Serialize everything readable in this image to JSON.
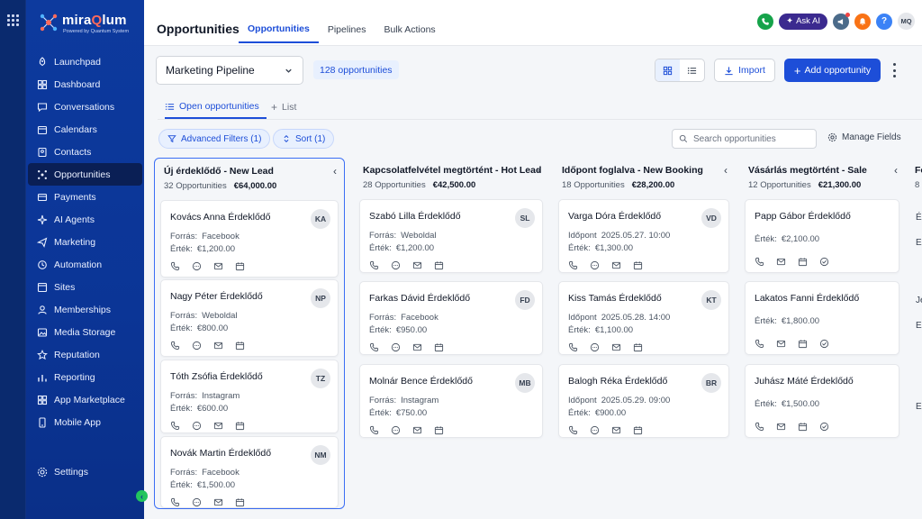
{
  "brand": {
    "name_pre": "mira",
    "name_accent": "Q",
    "name_post": "lum",
    "tagline": "Powered by Quantum System"
  },
  "sidebar": {
    "items": [
      {
        "label": "Launchpad",
        "icon": "rocket-icon"
      },
      {
        "label": "Dashboard",
        "icon": "dashboard-icon"
      },
      {
        "label": "Conversations",
        "icon": "chat-icon"
      },
      {
        "label": "Calendars",
        "icon": "calendar-icon"
      },
      {
        "label": "Contacts",
        "icon": "contacts-icon"
      },
      {
        "label": "Opportunities",
        "icon": "opportunities-icon",
        "active": true
      },
      {
        "label": "Payments",
        "icon": "payments-icon"
      },
      {
        "label": "AI Agents",
        "icon": "ai-agents-icon"
      },
      {
        "label": "Marketing",
        "icon": "marketing-icon"
      },
      {
        "label": "Automation",
        "icon": "automation-icon"
      },
      {
        "label": "Sites",
        "icon": "sites-icon"
      },
      {
        "label": "Memberships",
        "icon": "memberships-icon"
      },
      {
        "label": "Media Storage",
        "icon": "media-icon"
      },
      {
        "label": "Reputation",
        "icon": "star-icon"
      },
      {
        "label": "Reporting",
        "icon": "reporting-icon"
      },
      {
        "label": "App Marketplace",
        "icon": "marketplace-icon"
      },
      {
        "label": "Mobile App",
        "icon": "mobile-icon"
      }
    ],
    "settings_label": "Settings"
  },
  "header": {
    "title": "Opportunities",
    "tabs": [
      {
        "label": "Opportunities",
        "active": true
      },
      {
        "label": "Pipelines"
      },
      {
        "label": "Bulk Actions"
      }
    ],
    "ask_ai": "Ask AI",
    "help": "?",
    "avatar": "MQ",
    "colors": {
      "phone": "#16a34a",
      "askai": "#3b2a8f",
      "megaphone": "#4b6b8a",
      "bell": "#f97316",
      "help": "#3b82f6"
    }
  },
  "toolbar": {
    "pipeline": "Marketing Pipeline",
    "count": "128 opportunities",
    "import": "Import",
    "add": "Add opportunity"
  },
  "subtabs": {
    "open": "Open opportunities",
    "list": "List"
  },
  "filters": {
    "advanced": "Advanced Filters (1)",
    "sort": "Sort (1)",
    "search_placeholder": "Search opportunities",
    "manage": "Manage Fields"
  },
  "labels": {
    "source": "Forrás:",
    "value": "Érték:",
    "appointment": "Időpont"
  },
  "columns": [
    {
      "title": "Új érdeklődő - New Lead",
      "count": "32 Opportunities",
      "total": "€64,000.00",
      "cards": [
        {
          "name": "Kovács Anna Érdeklődő",
          "initials": "KA",
          "source": "Facebook",
          "value": "€1,200.00"
        },
        {
          "name": "Nagy Péter Érdeklődő",
          "initials": "NP",
          "source": "Weboldal",
          "value": "€800.00"
        },
        {
          "name": "Tóth Zsófia Érdeklődő",
          "initials": "TZ",
          "source": "Instagram",
          "value": "€600.00"
        },
        {
          "name": "Novák Martin Érdeklődő",
          "initials": "NM",
          "source": "Facebook",
          "value": "€1,500.00"
        }
      ]
    },
    {
      "title": "Kapcsolatfelvétel megtörtént - Hot Lead",
      "count": "28 Opportunities",
      "total": "€42,500.00",
      "cards": [
        {
          "name": "Szabó Lilla Érdeklődő",
          "initials": "SL",
          "source": "Weboldal",
          "value": "€1,200.00"
        },
        {
          "name": "Farkas Dávid Érdeklődő",
          "initials": "FD",
          "source": "Facebook",
          "value": "€950.00"
        },
        {
          "name": "Molnár Bence Érdeklődő",
          "initials": "MB",
          "source": "Instagram",
          "value": "€750.00"
        }
      ]
    },
    {
      "title": "Időpont foglalva - New Booking",
      "count": "18 Opportunities",
      "total": "€28,200.00",
      "cards": [
        {
          "name": "Varga Dóra Érdeklődő",
          "initials": "VD",
          "date": "2025.05.27. 10:00",
          "value": "€1,300.00"
        },
        {
          "name": "Kiss Tamás Érdeklődő",
          "initials": "KT",
          "date": "2025.05.28. 14:00",
          "value": "€1,100.00"
        },
        {
          "name": "Balogh Réka Érdeklődő",
          "initials": "BR",
          "date": "2025.05.29. 09:00",
          "value": "€900.00"
        }
      ]
    },
    {
      "title": "Vásárlás megtörtént - Sale",
      "count": "12 Opportunities",
      "total": "€21,300.00",
      "cards": [
        {
          "name": "Papp Gábor Érdeklődő",
          "value": "€2,100.00"
        },
        {
          "name": "Lakatos Fanni Érdeklődő",
          "value": "€1,800.00"
        },
        {
          "name": "Juhász Máté Érdeklődő",
          "value": "€1,500.00"
        }
      ]
    }
  ],
  "partial_column": {
    "title": "Fe",
    "count": "8",
    "card_initials": [
      "É",
      "E",
      "Je",
      "E",
      "E"
    ]
  }
}
